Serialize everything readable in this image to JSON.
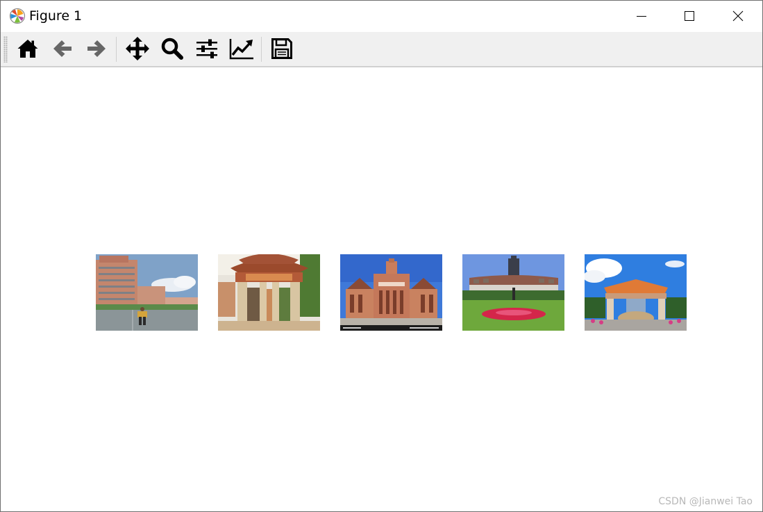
{
  "window": {
    "title": "Figure 1",
    "controls": {
      "minimize": "minimize-icon",
      "maximize": "maximize-icon",
      "close": "close-icon"
    }
  },
  "toolbar": {
    "tools": [
      {
        "id": "home",
        "icon": "home-icon"
      },
      {
        "id": "back",
        "icon": "arrow-left-icon"
      },
      {
        "id": "forward",
        "icon": "arrow-right-icon"
      },
      {
        "id": "pan",
        "icon": "move-arrows-icon"
      },
      {
        "id": "zoom",
        "icon": "magnifier-icon"
      },
      {
        "id": "subplots",
        "icon": "sliders-icon"
      },
      {
        "id": "edit-axes",
        "icon": "line-chart-icon"
      },
      {
        "id": "save",
        "icon": "floppy-disk-icon"
      }
    ]
  },
  "figure": {
    "images": [
      {
        "name": "image-1",
        "subject": "tall building with plaza and person walking"
      },
      {
        "name": "image-2",
        "subject": "traditional Chinese archway gate"
      },
      {
        "name": "image-3",
        "subject": "red brick hall with central tower"
      },
      {
        "name": "image-4",
        "subject": "building with tower behind flower garden"
      },
      {
        "name": "image-5",
        "subject": "gate pavilion with orange roof and rock"
      }
    ]
  },
  "watermark": "CSDN @Jianwei Tao"
}
